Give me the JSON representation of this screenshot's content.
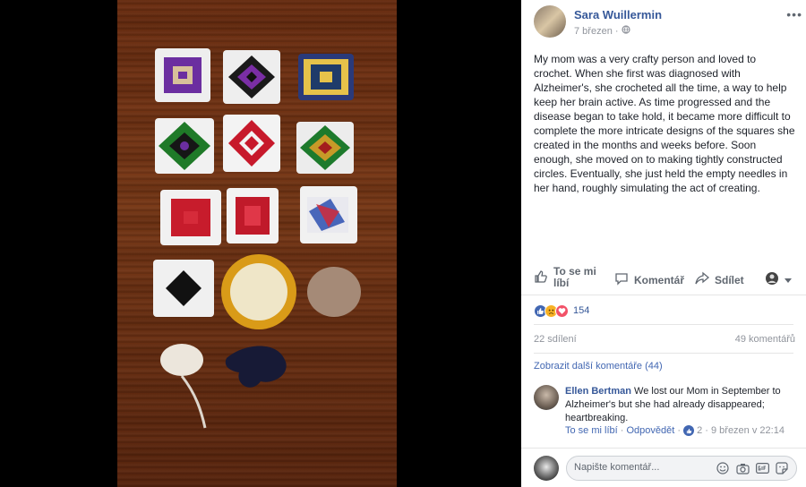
{
  "post": {
    "author": "Sara Wuillermin",
    "date": "7 březen",
    "privacy_icon": "globe-icon",
    "text": "My mom was a very crafty person and loved to crochet. When she first was diagnosed with Alzheimer's, she crocheted all the time, a way to help keep her brain active. As time progressed and the disease began to take hold, it became more difficult to complete the more intricate designs of the squares she created in the months and weeks before. Soon enough, she moved on to making tightly constructed circles. Eventually, she just held the empty needles in her hand, roughly simulating the act of creating."
  },
  "actions": {
    "like_line1": "To se mi",
    "like_line2": "líbí",
    "comment": "Komentář",
    "share": "Sdílet"
  },
  "reactions": {
    "types": [
      "like",
      "sad",
      "love"
    ],
    "count": "154",
    "colors": {
      "like": "#4267b2",
      "sad": "#f7b125",
      "love": "#f25268"
    }
  },
  "stats": {
    "shares": "22 sdílení",
    "comments": "49 komentářů"
  },
  "comments_section": {
    "more_link": "Zobrazit další komentáře (44)",
    "comment": {
      "author": "Ellen Bertman",
      "text": " We lost our Mom in September to Alzheimer's but she had already disappeared; heartbreaking.",
      "like": "To se mi líbí",
      "reply": "Odpovědět",
      "reaction_count": "2",
      "timestamp": "9 březen v 22:14"
    }
  },
  "composer": {
    "placeholder": "Napište komentář...",
    "icons": [
      "emoji-icon",
      "camera-icon",
      "gif-icon",
      "sticker-icon"
    ]
  }
}
